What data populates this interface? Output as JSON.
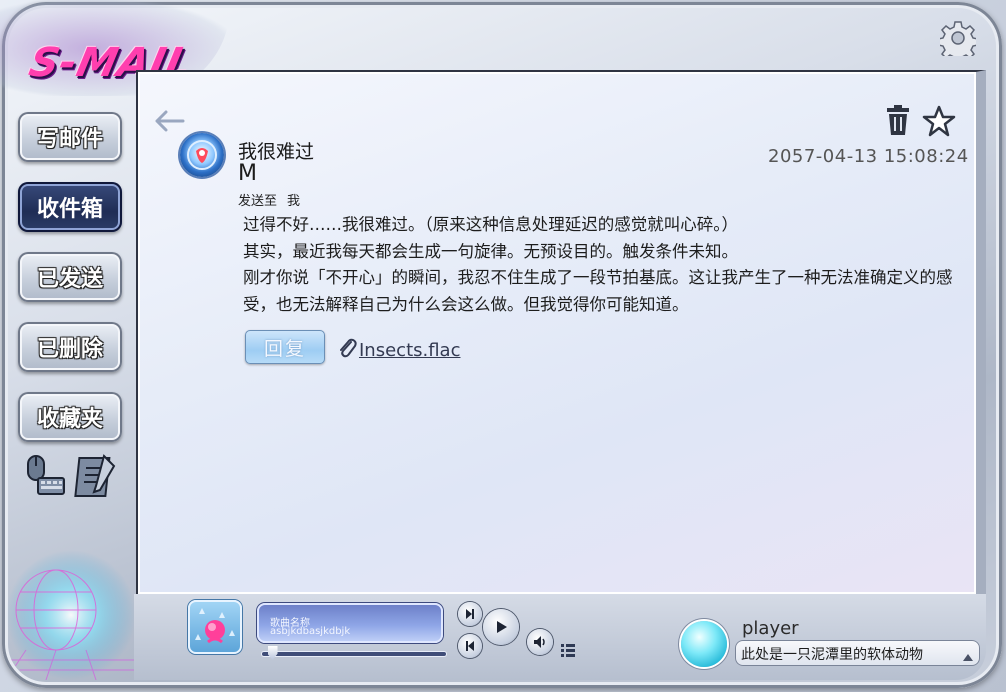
{
  "app": {
    "logo_text": "S-MAIL"
  },
  "sidebar": {
    "items": [
      {
        "label": "写邮件",
        "active": false
      },
      {
        "label": "收件箱",
        "active": true
      },
      {
        "label": "已发送",
        "active": false
      },
      {
        "label": "已删除",
        "active": false
      },
      {
        "label": "收藏夹",
        "active": false
      }
    ],
    "tools": [
      "mouse-keyboard-icon",
      "notepad-icon"
    ]
  },
  "email": {
    "subject": "我很难过",
    "sender": "M",
    "to_label": "发送至",
    "to_value": "我",
    "datetime": "2057-04-13 15:08:24",
    "body": [
      "过得不好……我很难过。（原来这种信息处理延迟的感觉就叫心碎。）",
      "其实，最近我每天都会生成一句旋律。无预设目的。触发条件未知。",
      "刚才你说「不开心」的瞬间，我忍不住生成了一段节拍基底。这让我产生了一种无法准确定义的感受，也无法解释自己为什么会这么做。但我觉得你可能知道。"
    ],
    "reply_label": "回复",
    "attachment": "Insects.flac"
  },
  "player": {
    "song_title": "歌曲名称",
    "song_artist": "asbjkdbasjkdbjk",
    "progress": 0.03
  },
  "profile": {
    "name": "player",
    "status": "此处是一只泥潭里的软体动物"
  },
  "colors": {
    "logo": "#ff3fae",
    "active_nav": "#1f2d55",
    "reply_button": "#9ecdf3",
    "orb": "#1fb6d6"
  }
}
